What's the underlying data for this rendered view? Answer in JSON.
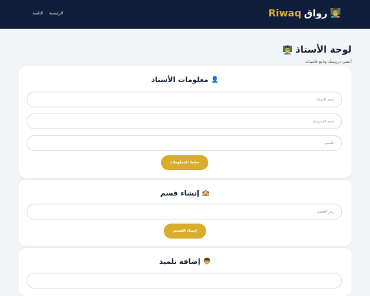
{
  "header": {
    "brand_emoji": "👨‍🏫",
    "brand_ar": "رواق",
    "brand_en": "Riwaq",
    "nav": [
      {
        "label": "الرئيسية"
      },
      {
        "label": "التلميذ"
      }
    ]
  },
  "page": {
    "title": "لوحة الأستاذ",
    "title_emoji": "👨‍🏫",
    "subtitle": "أنشئ دروسك وتابع تلاميذك"
  },
  "teacher_info": {
    "title": "معلومات الأستاذ",
    "emoji": "👤",
    "name_placeholder": "اسم الأستاذ",
    "school_placeholder": "اسم المدرسة",
    "class_placeholder": "القسم",
    "save_label": "حفظ المعلومات"
  },
  "create_class": {
    "title": "إنشاء قسم",
    "emoji": "🏫",
    "code_placeholder": "رمز القسم",
    "create_label": "إنشاء القسم"
  },
  "add_student": {
    "title": "إضافة تلميذ",
    "emoji": "👦"
  }
}
